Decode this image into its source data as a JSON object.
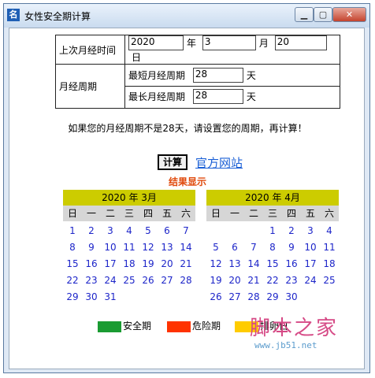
{
  "window": {
    "title": "女性安全期计算",
    "icon_char": "名"
  },
  "form": {
    "last_period_label": "上次月经时间",
    "year_value": "2020",
    "year_unit": "年",
    "month_value": "3",
    "month_unit": "月",
    "day_value": "20",
    "day_unit": "日",
    "cycle_label": "月经周期",
    "shortest_label": "最短月经周期",
    "shortest_value": "28",
    "shortest_unit": "天",
    "longest_label": "最长月经周期",
    "longest_value": "28",
    "longest_unit": "天"
  },
  "notice": "如果您的月经周期不是28天，请设置您的周期，再计算！",
  "actions": {
    "calc_label": "计算",
    "official_link": "官方网站"
  },
  "result_title": "结果显示",
  "weekdays": [
    "日",
    "一",
    "二",
    "三",
    "四",
    "五",
    "六"
  ],
  "calendars": [
    {
      "title": "2020 年  3月",
      "first_weekday": 0,
      "days": 31
    },
    {
      "title": "2020 年  4月",
      "first_weekday": 3,
      "days": 30
    }
  ],
  "legend": [
    {
      "label": "安全期",
      "color": "#1a9b32"
    },
    {
      "label": "危险期",
      "color": "#ff3300"
    },
    {
      "label": "排卵日",
      "color": "#ffcc00"
    }
  ],
  "watermark": {
    "text": "脚本之家",
    "url": "www.jb51.net"
  }
}
